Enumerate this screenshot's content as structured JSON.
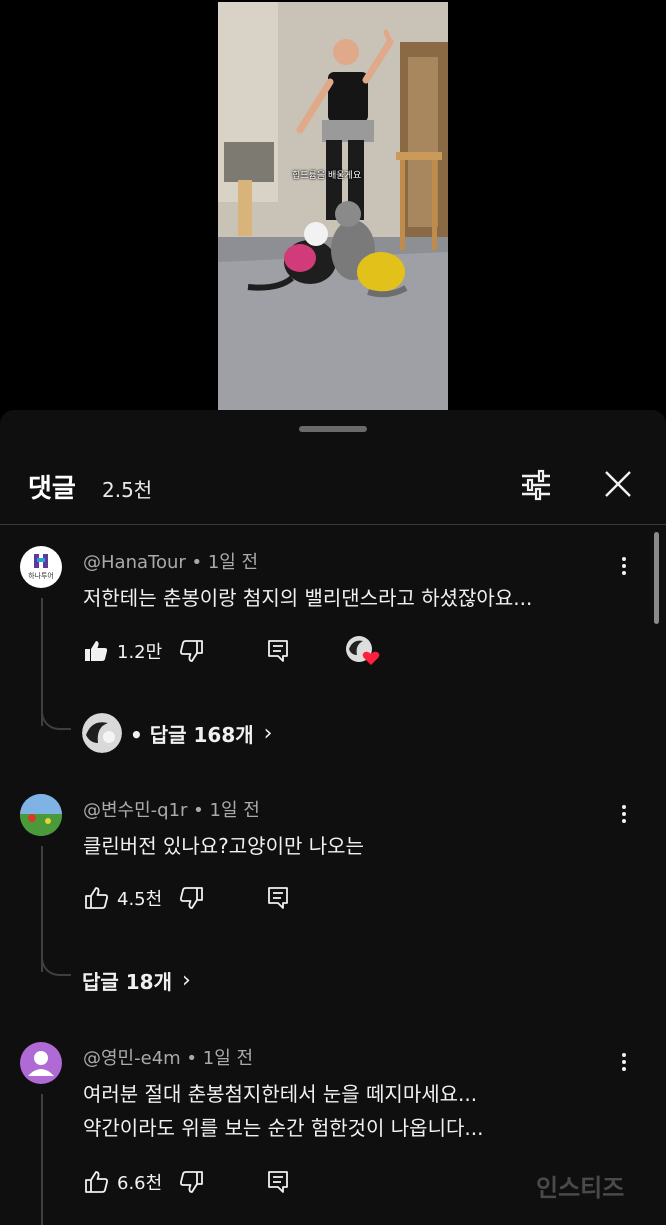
{
  "video": {
    "caption": "힙드륨을 배울게요"
  },
  "sheet": {
    "title": "댓글",
    "count": "2.5천"
  },
  "comments": [
    {
      "meta": "@HanaTour • 1일 전",
      "avatar_label": "하나투어",
      "lines": [
        "저한테는 춘봉이랑 첨지의 밸리댄스라고 하셨잖아요..."
      ],
      "likes": "1.2만",
      "liked": true,
      "creator_heart": true,
      "replies": "• 답글 168개"
    },
    {
      "meta": "@변수민-q1r • 1일 전",
      "lines": [
        "클린버전 있나요?고양이만 나오는"
      ],
      "likes": "4.5천",
      "liked": false,
      "replies": "답글 18개"
    },
    {
      "meta": "@영민-e4m • 1일 전",
      "lines": [
        "여러분 절대 춘봉첨지한테서 눈을 떼지마세요...",
        "약간이라도 위를 보는 순간 험한것이 나옵니다..."
      ],
      "likes": "6.6천",
      "liked": false
    }
  ],
  "watermark": "인스티즈",
  "colors": {
    "background": "#0f0f0f",
    "heart": "#ff1f3d",
    "avatar_purple": "#b06ad6"
  }
}
